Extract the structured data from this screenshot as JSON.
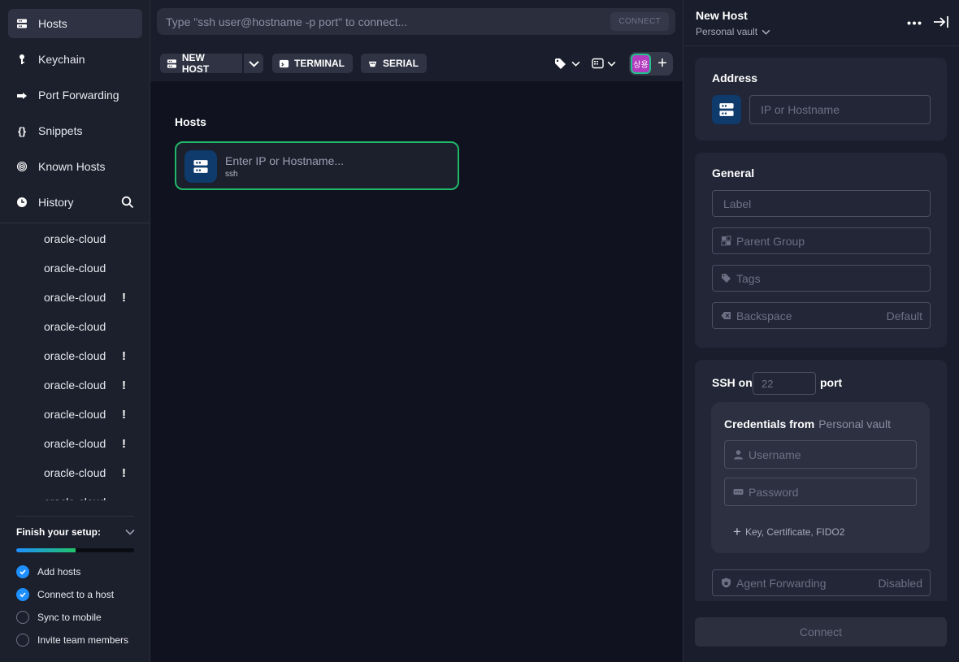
{
  "sidebar": {
    "nav": [
      {
        "label": "Hosts",
        "icon": "server-icon"
      },
      {
        "label": "Keychain",
        "icon": "key-icon"
      },
      {
        "label": "Port Forwarding",
        "icon": "arrow-forward-icon"
      },
      {
        "label": "Snippets",
        "icon": "braces-icon"
      },
      {
        "label": "Known Hosts",
        "icon": "fingerprint-icon"
      },
      {
        "label": "History",
        "icon": "clock-icon"
      }
    ],
    "history": [
      {
        "label": "oracle-cloud",
        "warn": ""
      },
      {
        "label": "oracle-cloud",
        "warn": ""
      },
      {
        "label": "oracle-cloud",
        "warn": "!"
      },
      {
        "label": "oracle-cloud",
        "warn": ""
      },
      {
        "label": "oracle-cloud",
        "warn": "!"
      },
      {
        "label": "oracle-cloud",
        "warn": "!"
      },
      {
        "label": "oracle-cloud",
        "warn": "!"
      },
      {
        "label": "oracle-cloud",
        "warn": "!"
      },
      {
        "label": "oracle-cloud",
        "warn": "!"
      },
      {
        "label": "oracle-cloud",
        "warn": ""
      }
    ],
    "setup": {
      "title": "Finish your setup:",
      "progress": 0.5,
      "tasks": [
        {
          "label": "Add hosts",
          "done": true
        },
        {
          "label": "Connect to a host",
          "done": true
        },
        {
          "label": "Sync to mobile",
          "done": false
        },
        {
          "label": "Invite team members",
          "done": false
        }
      ]
    }
  },
  "topbar": {
    "quick_connect_placeholder": "Type \"ssh user@hostname -p port\" to connect...",
    "connect_label": "CONNECT",
    "new_host_label": "NEW HOST",
    "terminal_label": "TERMINAL",
    "serial_label": "SERIAL",
    "avatar_text": "상용"
  },
  "main": {
    "section_title": "Hosts",
    "host_card": {
      "title": "Enter IP or Hostname...",
      "subtitle": "ssh"
    }
  },
  "panel": {
    "title": "New Host",
    "vault": "Personal vault",
    "address": {
      "title": "Address",
      "placeholder": "IP or Hostname"
    },
    "general": {
      "title": "General",
      "label_placeholder": "Label",
      "parent_group_placeholder": "Parent Group",
      "tags_placeholder": "Tags",
      "backspace_label": "Backspace",
      "backspace_value": "Default"
    },
    "ssh": {
      "prefix": "SSH on",
      "port_placeholder": "22",
      "suffix": "port",
      "credentials_label": "Credentials from",
      "credentials_vault": "Personal vault",
      "username_placeholder": "Username",
      "password_placeholder": "Password",
      "key_link": "Key, Certificate, FIDO2",
      "agent_forwarding_label": "Agent Forwarding",
      "agent_forwarding_value": "Disabled"
    },
    "connect_label": "Connect"
  }
}
